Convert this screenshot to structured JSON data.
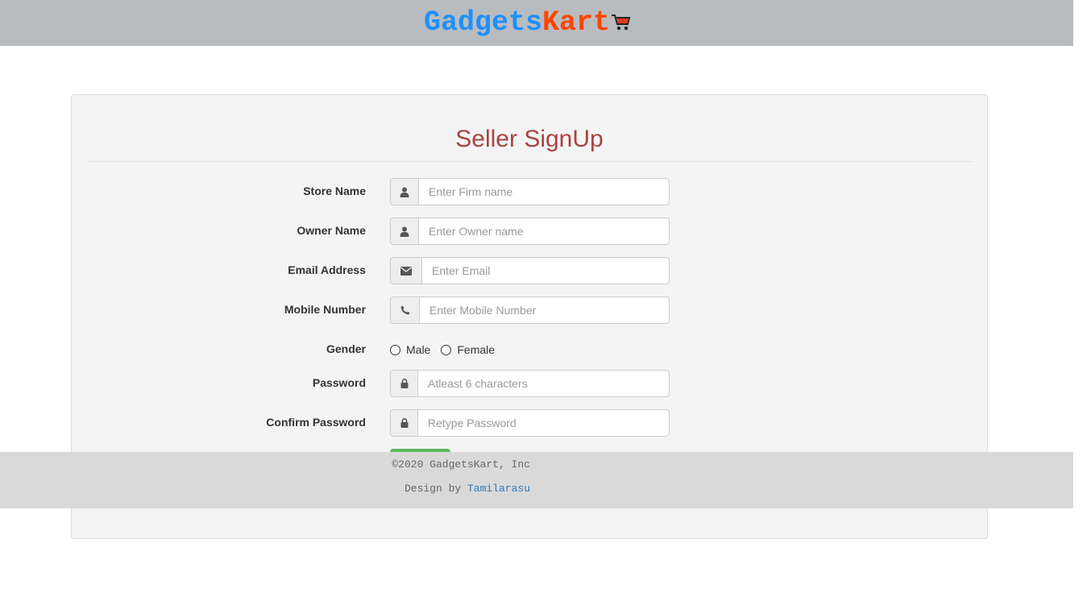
{
  "header": {
    "brand_part1": "Gadgets",
    "brand_part2": "Kart",
    "brand_color1": "#1e90ff",
    "brand_color2": "#ff4500",
    "cart_icon": "shopping-cart-icon"
  },
  "form": {
    "title": "Seller SignUp",
    "title_color": "#a94442",
    "fields": [
      {
        "label": "Store Name",
        "icon": "user-icon",
        "placeholder": "Enter Firm name",
        "value": ""
      },
      {
        "label": "Owner Name",
        "icon": "user-icon",
        "placeholder": "Enter Owner name",
        "value": ""
      },
      {
        "label": "Email Address",
        "icon": "envelope-icon",
        "placeholder": "Enter Email",
        "value": ""
      },
      {
        "label": "Mobile Number",
        "icon": "phone-icon",
        "placeholder": "Enter Mobile Number",
        "value": ""
      }
    ],
    "gender": {
      "label": "Gender",
      "options": [
        "Male",
        "Female"
      ],
      "selected": null
    },
    "password": {
      "label": "Password",
      "icon": "lock-icon",
      "placeholder": "Atleast 6 characters"
    },
    "confirm_password": {
      "label": "Confirm Password",
      "icon": "lock-icon",
      "placeholder": "Retype Password"
    },
    "submit_color": "#5cb85c"
  },
  "footer": {
    "copyright": "©2020 GadgetsKart, Inc",
    "design_prefix": "Design by ",
    "designer": "Tamilarasu",
    "designer_color": "#337ab7"
  }
}
